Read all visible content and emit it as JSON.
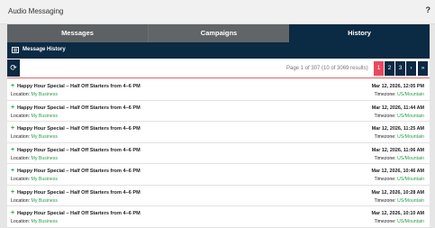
{
  "app": {
    "title": "Audio Messaging",
    "help": "?"
  },
  "tabs": [
    {
      "label": "Messages"
    },
    {
      "label": "Campaigns"
    },
    {
      "label": "History"
    }
  ],
  "section": {
    "title": "Message History"
  },
  "toolbar": {
    "refresh_icon": "refresh-icon"
  },
  "pagination": {
    "info": "Page 1 of 307 (10 of 3069 results)",
    "pages": [
      "1",
      "2",
      "3"
    ],
    "next": "›",
    "last": "»",
    "active": "1"
  },
  "history": [
    {
      "title": "Happy Hour Special – Half Off Starters from 4–6 PM",
      "location_label": "Location:",
      "location": "My Business",
      "date": "Mar 12, 2026, 12:05 PM",
      "timezone_label": "Timezone:",
      "timezone": "US/Mountain"
    },
    {
      "title": "Happy Hour Special – Half Off Starters from 4–6 PM",
      "location_label": "Location:",
      "location": "My Business",
      "date": "Mar 12, 2026, 11:44 AM",
      "timezone_label": "Timezone:",
      "timezone": "US/Mountain"
    },
    {
      "title": "Happy Hour Special – Half Off Starters from 4–6 PM",
      "location_label": "Location:",
      "location": "My Business",
      "date": "Mar 12, 2026, 11:25 AM",
      "timezone_label": "Timezone:",
      "timezone": "US/Mountain"
    },
    {
      "title": "Happy Hour Special – Half Off Starters from 4–6 PM",
      "location_label": "Location:",
      "location": "My Business",
      "date": "Mar 12, 2026, 11:06 AM",
      "timezone_label": "Timezone:",
      "timezone": "US/Mountain"
    },
    {
      "title": "Happy Hour Special – Half Off Starters from 4–6 PM",
      "location_label": "Location:",
      "location": "My Business",
      "date": "Mar 12, 2026, 10:46 AM",
      "timezone_label": "Timezone:",
      "timezone": "US/Mountain"
    },
    {
      "title": "Happy Hour Special – Half Off Starters from 4–6 PM",
      "location_label": "Location:",
      "location": "My Business",
      "date": "Mar 12, 2026, 10:28 AM",
      "timezone_label": "Timezone:",
      "timezone": "US/Mountain"
    },
    {
      "title": "Happy Hour Special – Half Off Starters from 4–6 PM",
      "location_label": "Location:",
      "location": "My Business",
      "date": "Mar 12, 2026, 10:10 AM",
      "timezone_label": "Timezone:",
      "timezone": "US/Mountain"
    }
  ],
  "colors": {
    "navy": "#0b2a43",
    "accent_red": "#e84a5f",
    "green": "#2aa04a"
  }
}
